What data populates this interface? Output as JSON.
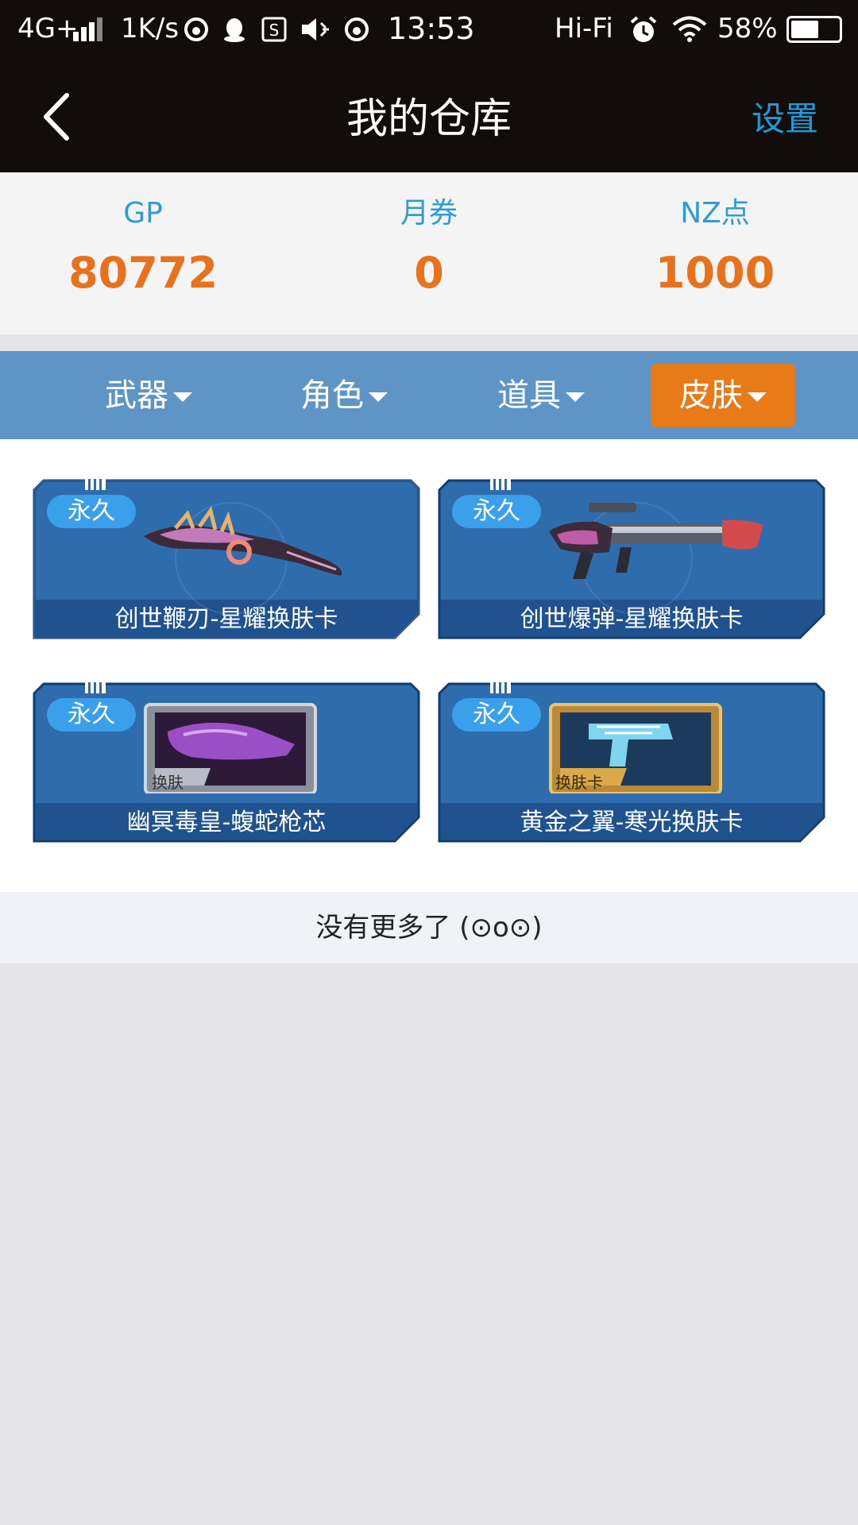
{
  "status_bar": {
    "network": "4G+",
    "speed": "1K/s",
    "time": "13:53",
    "audio": "Hi-Fi",
    "battery_percent": "58%",
    "battery_level": 0.58
  },
  "header": {
    "title": "我的仓库",
    "settings_label": "设置"
  },
  "currency": [
    {
      "label": "GP",
      "value": "80772"
    },
    {
      "label": "月券",
      "value": "0"
    },
    {
      "label": "NZ点",
      "value": "1000"
    }
  ],
  "filters": [
    {
      "label": "武器",
      "active": false
    },
    {
      "label": "角色",
      "active": false
    },
    {
      "label": "道具",
      "active": false
    },
    {
      "label": "皮肤",
      "active": true
    }
  ],
  "items": [
    {
      "badge": "永久",
      "name": "创世鞭刃-星耀换肤卡",
      "image": "blade-weapon-image"
    },
    {
      "badge": "永久",
      "name": "创世爆弹-星耀换肤卡",
      "image": "launcher-weapon-image"
    },
    {
      "badge": "永久",
      "name": "幽冥毒皇-蝮蛇枪芯",
      "image": "skin-card-purple-image",
      "card_label": "换肤"
    },
    {
      "badge": "永久",
      "name": "黄金之翼-寒光换肤卡",
      "image": "skin-card-gold-image",
      "card_label": "换肤卡"
    }
  ],
  "footer": {
    "no_more_text": "没有更多了 (⊙o⊙)"
  },
  "colors": {
    "header_bg": "#120d0a",
    "accent_blue": "#1e9bdc",
    "value_orange": "#e8711b",
    "filter_bg": "#5f95c6",
    "active_tab": "#e87a17",
    "card_blue": "#2f6cae"
  }
}
